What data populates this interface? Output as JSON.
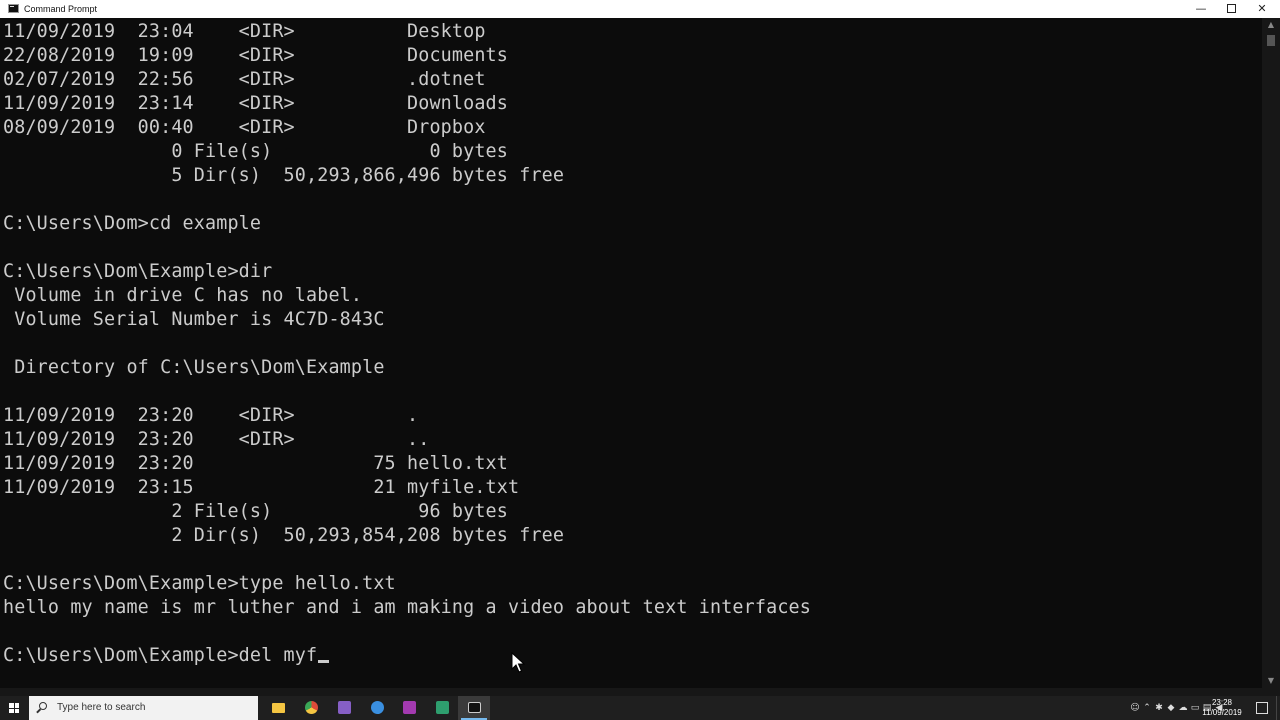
{
  "window": {
    "title": "Command Prompt",
    "minimize_glyph": "—",
    "close_glyph": "✕"
  },
  "console": {
    "lines": [
      "11/09/2019  23:04    <DIR>          Desktop",
      "22/08/2019  19:09    <DIR>          Documents",
      "02/07/2019  22:56    <DIR>          .dotnet",
      "11/09/2019  23:14    <DIR>          Downloads",
      "08/09/2019  00:40    <DIR>          Dropbox",
      "               0 File(s)              0 bytes",
      "               5 Dir(s)  50,293,866,496 bytes free",
      "",
      "C:\\Users\\Dom>cd example",
      "",
      "C:\\Users\\Dom\\Example>dir",
      " Volume in drive C has no label.",
      " Volume Serial Number is 4C7D-843C",
      "",
      " Directory of C:\\Users\\Dom\\Example",
      "",
      "11/09/2019  23:20    <DIR>          .",
      "11/09/2019  23:20    <DIR>          ..",
      "11/09/2019  23:20                75 hello.txt",
      "11/09/2019  23:15                21 myfile.txt",
      "               2 File(s)             96 bytes",
      "               2 Dir(s)  50,293,854,208 bytes free",
      "",
      "C:\\Users\\Dom\\Example>type hello.txt",
      "hello my name is mr luther and i am making a video about text interfaces",
      ""
    ],
    "prompt": "C:\\Users\\Dom\\Example>",
    "current_input": "del myf"
  },
  "taskbar": {
    "search_placeholder": "Type here to search",
    "apps": [
      {
        "name": "file-explorer",
        "color": "#f4c542"
      },
      {
        "name": "chrome",
        "color": "#dd4b39"
      },
      {
        "name": "visual-studio",
        "color": "#865fc5"
      },
      {
        "name": "firefox",
        "color": "#3a8fe0"
      },
      {
        "name": "onenote",
        "color": "#a33ab0"
      },
      {
        "name": "app-green",
        "color": "#2e9e6e"
      },
      {
        "name": "command-prompt",
        "color": "#cccccc"
      }
    ],
    "clock_time": "23:28",
    "clock_date": "11/09/2019"
  }
}
